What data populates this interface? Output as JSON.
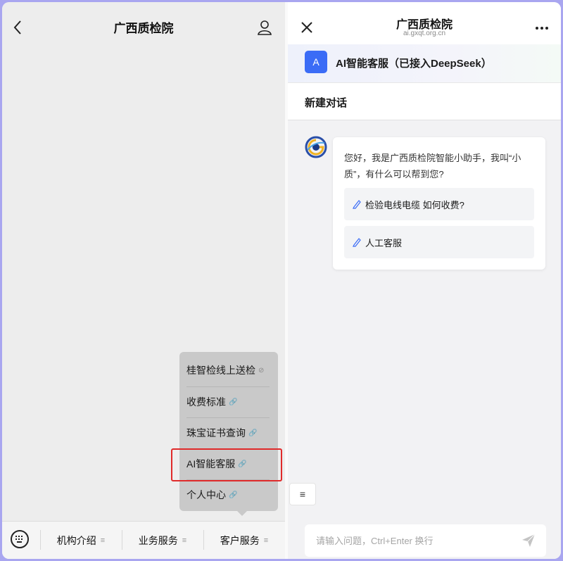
{
  "left": {
    "title": "广西质检院",
    "menu": {
      "items": [
        {
          "label": "桂智检线上送检",
          "icon": "⊘"
        },
        {
          "label": "收费标准",
          "icon": "🔗"
        },
        {
          "label": "珠宝证书查询",
          "icon": "🔗"
        },
        {
          "label": "AI智能客服",
          "icon": "🔗"
        },
        {
          "label": "个人中心",
          "icon": "🔗"
        }
      ]
    },
    "tabs": [
      {
        "label": "机构介绍",
        "icon": "≡"
      },
      {
        "label": "业务服务",
        "icon": "≡"
      },
      {
        "label": "客户服务",
        "icon": "≡"
      }
    ]
  },
  "right": {
    "title": "广西质检院",
    "url": "ai.gxqt.org.cn",
    "bot": {
      "avatar_letter": "A",
      "name": "AI智能客服（已接入DeepSeek）"
    },
    "new_chat": "新建对话",
    "greeting": "您好，我是广西质检院智能小助手，我叫“小质”，有什么可以帮到您?",
    "suggestions": [
      "检验电线电缆 如何收费?",
      "人工客服"
    ],
    "list_icon": "≡",
    "input": {
      "placeholder": "请输入问题，Ctrl+Enter 换行",
      "value": ""
    }
  },
  "colors": {
    "accent": "#3b6cf6",
    "highlight": "#e02a2a"
  }
}
